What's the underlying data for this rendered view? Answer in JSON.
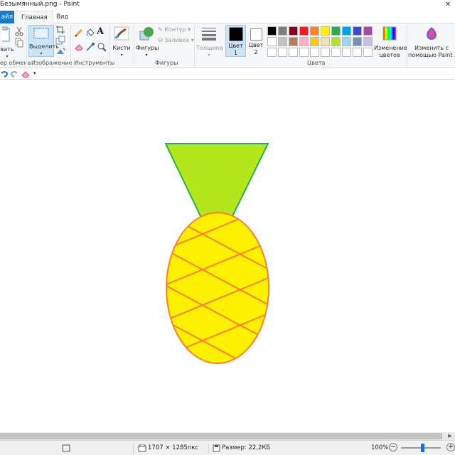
{
  "window": {
    "title": "Безымянный.png - Paint",
    "close_glyph": "✕"
  },
  "tabs": [
    {
      "label": "айл"
    },
    {
      "label": "Главная"
    },
    {
      "label": "Вид"
    }
  ],
  "ribbon": {
    "clipboard": {
      "paste_label": "вить",
      "group_label": "ер обмена"
    },
    "image": {
      "select_label": "Выделить",
      "group_label": "Изображение"
    },
    "tools": {
      "group_label": "Инструменты",
      "text_glyph": "A"
    },
    "brushes": {
      "label": "Кисти"
    },
    "shapes": {
      "label": "Фигуры",
      "group_label": "Фигуры",
      "outline_label": "Контур",
      "fill_label": "Заливка"
    },
    "thickness": {
      "label": "Толщина"
    },
    "colors": {
      "color1_label": "Цвет",
      "color1_num": "1",
      "color2_label": "Цвет",
      "color2_num": "2",
      "color1_value": "#000000",
      "color2_value": "#ffffff",
      "group_label": "Цвета",
      "edit_label_1": "Изменение",
      "edit_label_2": "цветов",
      "palette_row1": [
        "#000000",
        "#7f7f7f",
        "#880015",
        "#ed1c24",
        "#ff7f27",
        "#fff200",
        "#22b14c",
        "#00a2e8",
        "#3f48cc",
        "#a349a4"
      ],
      "palette_row2": [
        "#ffffff",
        "#c3c3c3",
        "#b97a57",
        "#ffaec9",
        "#ffc90e",
        "#efe4b0",
        "#b5e61d",
        "#99d9ea",
        "#7092be",
        "#c8bfe7"
      ],
      "palette_row3_count": 10
    },
    "paint3d": {
      "label_1": "Изменить с",
      "label_2": "помощью Paint 3D"
    }
  },
  "canvas": {
    "pineapple": {
      "leaves_color": "#b5e61d",
      "leaves_stroke": "#22b14c",
      "body_color": "#fff200",
      "body_stroke": "#ff7f27"
    }
  },
  "status": {
    "dimensions": "1707 × 1285пкс",
    "size": "Размер: 22,2КБ",
    "zoom": "100%",
    "zoom_out_glyph": "−",
    "zoom_in_glyph": "+"
  }
}
